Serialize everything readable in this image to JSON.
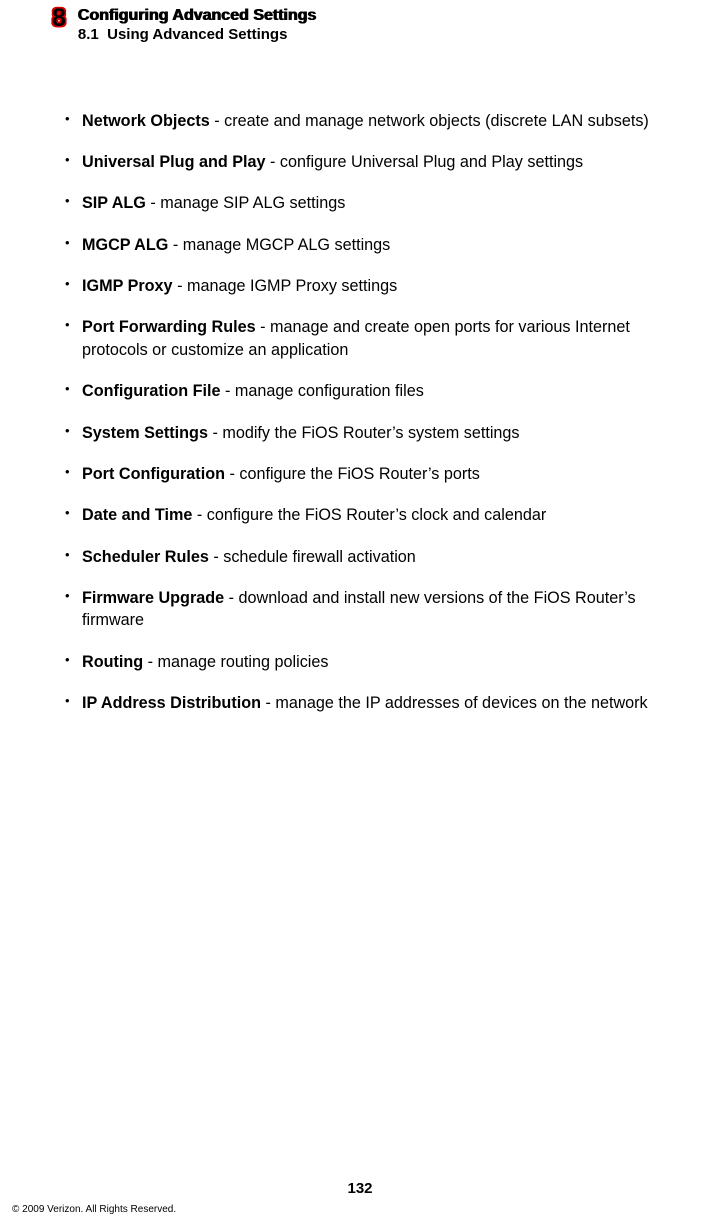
{
  "header": {
    "chapter_number": "8",
    "title": "Configuring Advanced Settings",
    "section_number": "8.1",
    "section_title": "Using Advanced Settings"
  },
  "items": [
    {
      "term": "Network Objects",
      "desc": " - create and manage network objects (discrete LAN subsets)"
    },
    {
      "term": "Universal Plug and Play",
      "desc": " - configure Universal Plug and Play settings"
    },
    {
      "term": "SIP ALG",
      "desc": " - manage SIP ALG settings"
    },
    {
      "term": "MGCP ALG",
      "desc": " - manage MGCP ALG settings"
    },
    {
      "term": "IGMP Proxy",
      "desc": " - manage IGMP Proxy settings"
    },
    {
      "term": "Port Forwarding Rules",
      "desc": " - manage and create open ports for various Internet protocols or customize an application"
    },
    {
      "term": "Configuration File",
      "desc": " - manage configuration files"
    },
    {
      "term": "System Settings",
      "desc": " - modify the FiOS Router’s system settings"
    },
    {
      "term": "Port Configuration",
      "desc": " - configure the FiOS Router’s ports"
    },
    {
      "term": "Date and Time",
      "desc": " - configure the FiOS Router’s clock and calendar"
    },
    {
      "term": "Scheduler Rules",
      "desc": " - schedule firewall activation"
    },
    {
      "term": "Firmware Upgrade",
      "desc": " - download and install new versions of the FiOS Router’s firmware"
    },
    {
      "term": "Routing",
      "desc": " - manage routing policies"
    },
    {
      "term": "IP Address Distribution",
      "desc": " - manage the IP addresses of devices on the network"
    }
  ],
  "page_number": "132",
  "copyright": "© 2009 Verizon. All Rights Reserved."
}
